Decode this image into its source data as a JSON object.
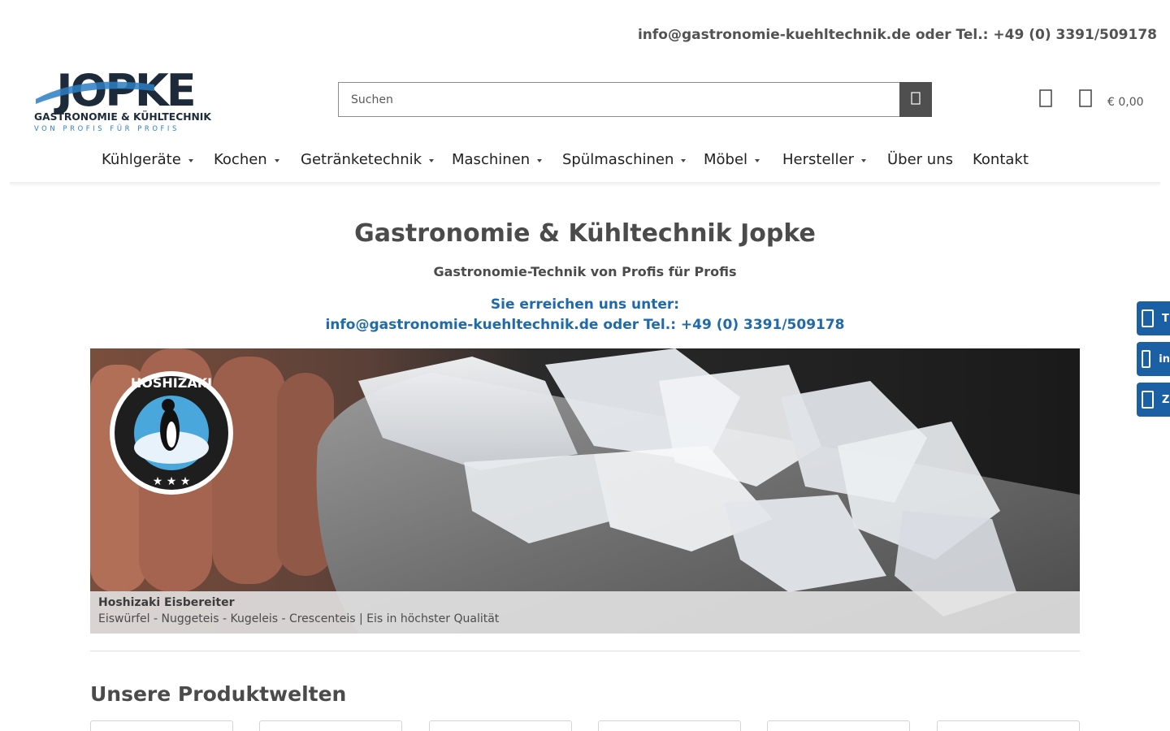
{
  "topbar": {
    "contact_line": "info@gastronomie-kuehltechnik.de oder Tel.: +49 (0) 3391/509178"
  },
  "logo": {
    "wordmark": "JOPKE",
    "line1": "GASTRONOMIE & KÜHLTECHNIK",
    "line2": "VON PROFIS FÜR PROFIS",
    "colors": {
      "dark": "#1d2a3a",
      "blue": "#2b7fc4"
    }
  },
  "search": {
    "placeholder": "Suchen",
    "button_icon": "search-icon"
  },
  "header_actions": {
    "wishlist_icon": "heart-icon",
    "cart_icon": "bag-icon",
    "cart_total": "€ 0,00"
  },
  "nav": {
    "items": [
      {
        "label": "Kühlgeräte",
        "has_dropdown": true
      },
      {
        "label": "Kochen",
        "has_dropdown": true
      },
      {
        "label": "Getränketechnik",
        "has_dropdown": true
      },
      {
        "label": "Maschinen",
        "has_dropdown": true
      },
      {
        "label": "Spülmaschinen",
        "has_dropdown": true
      },
      {
        "label": "Möbel",
        "has_dropdown": true
      },
      {
        "label": "Hersteller",
        "has_dropdown": true
      },
      {
        "label": "Über uns",
        "has_dropdown": false
      },
      {
        "label": "Kontakt",
        "has_dropdown": false
      }
    ]
  },
  "hero": {
    "title": "Gastronomie & Kühltechnik Jopke",
    "subtitle": "Gastronomie-Technik von Profis für Profis",
    "reach_line1": "Sie erreichen uns unter:",
    "reach_line2": "info@gastronomie-kuehltechnik.de oder Tel.: +49 (0) 3391/509178"
  },
  "banner": {
    "badge_text": "HOSHIZAKI",
    "caption_title": "Hoshizaki Eisbereiter",
    "caption_text": "Eiswürfel - Nuggeteis - Kugeleis - Crescenteis | Eis in höchster Qualität"
  },
  "products": {
    "section_title": "Unsere Produktwelten",
    "tile_count": 6
  },
  "side_tabs": [
    {
      "icon": "phone-icon",
      "label": "T"
    },
    {
      "icon": "mail-icon",
      "label": "in"
    },
    {
      "icon": "document-icon",
      "label": "Z"
    }
  ],
  "colors": {
    "accent_blue": "#1f6aa8",
    "side_tab_blue": "#1b5fa4",
    "search_button": "#4f4f4f"
  }
}
